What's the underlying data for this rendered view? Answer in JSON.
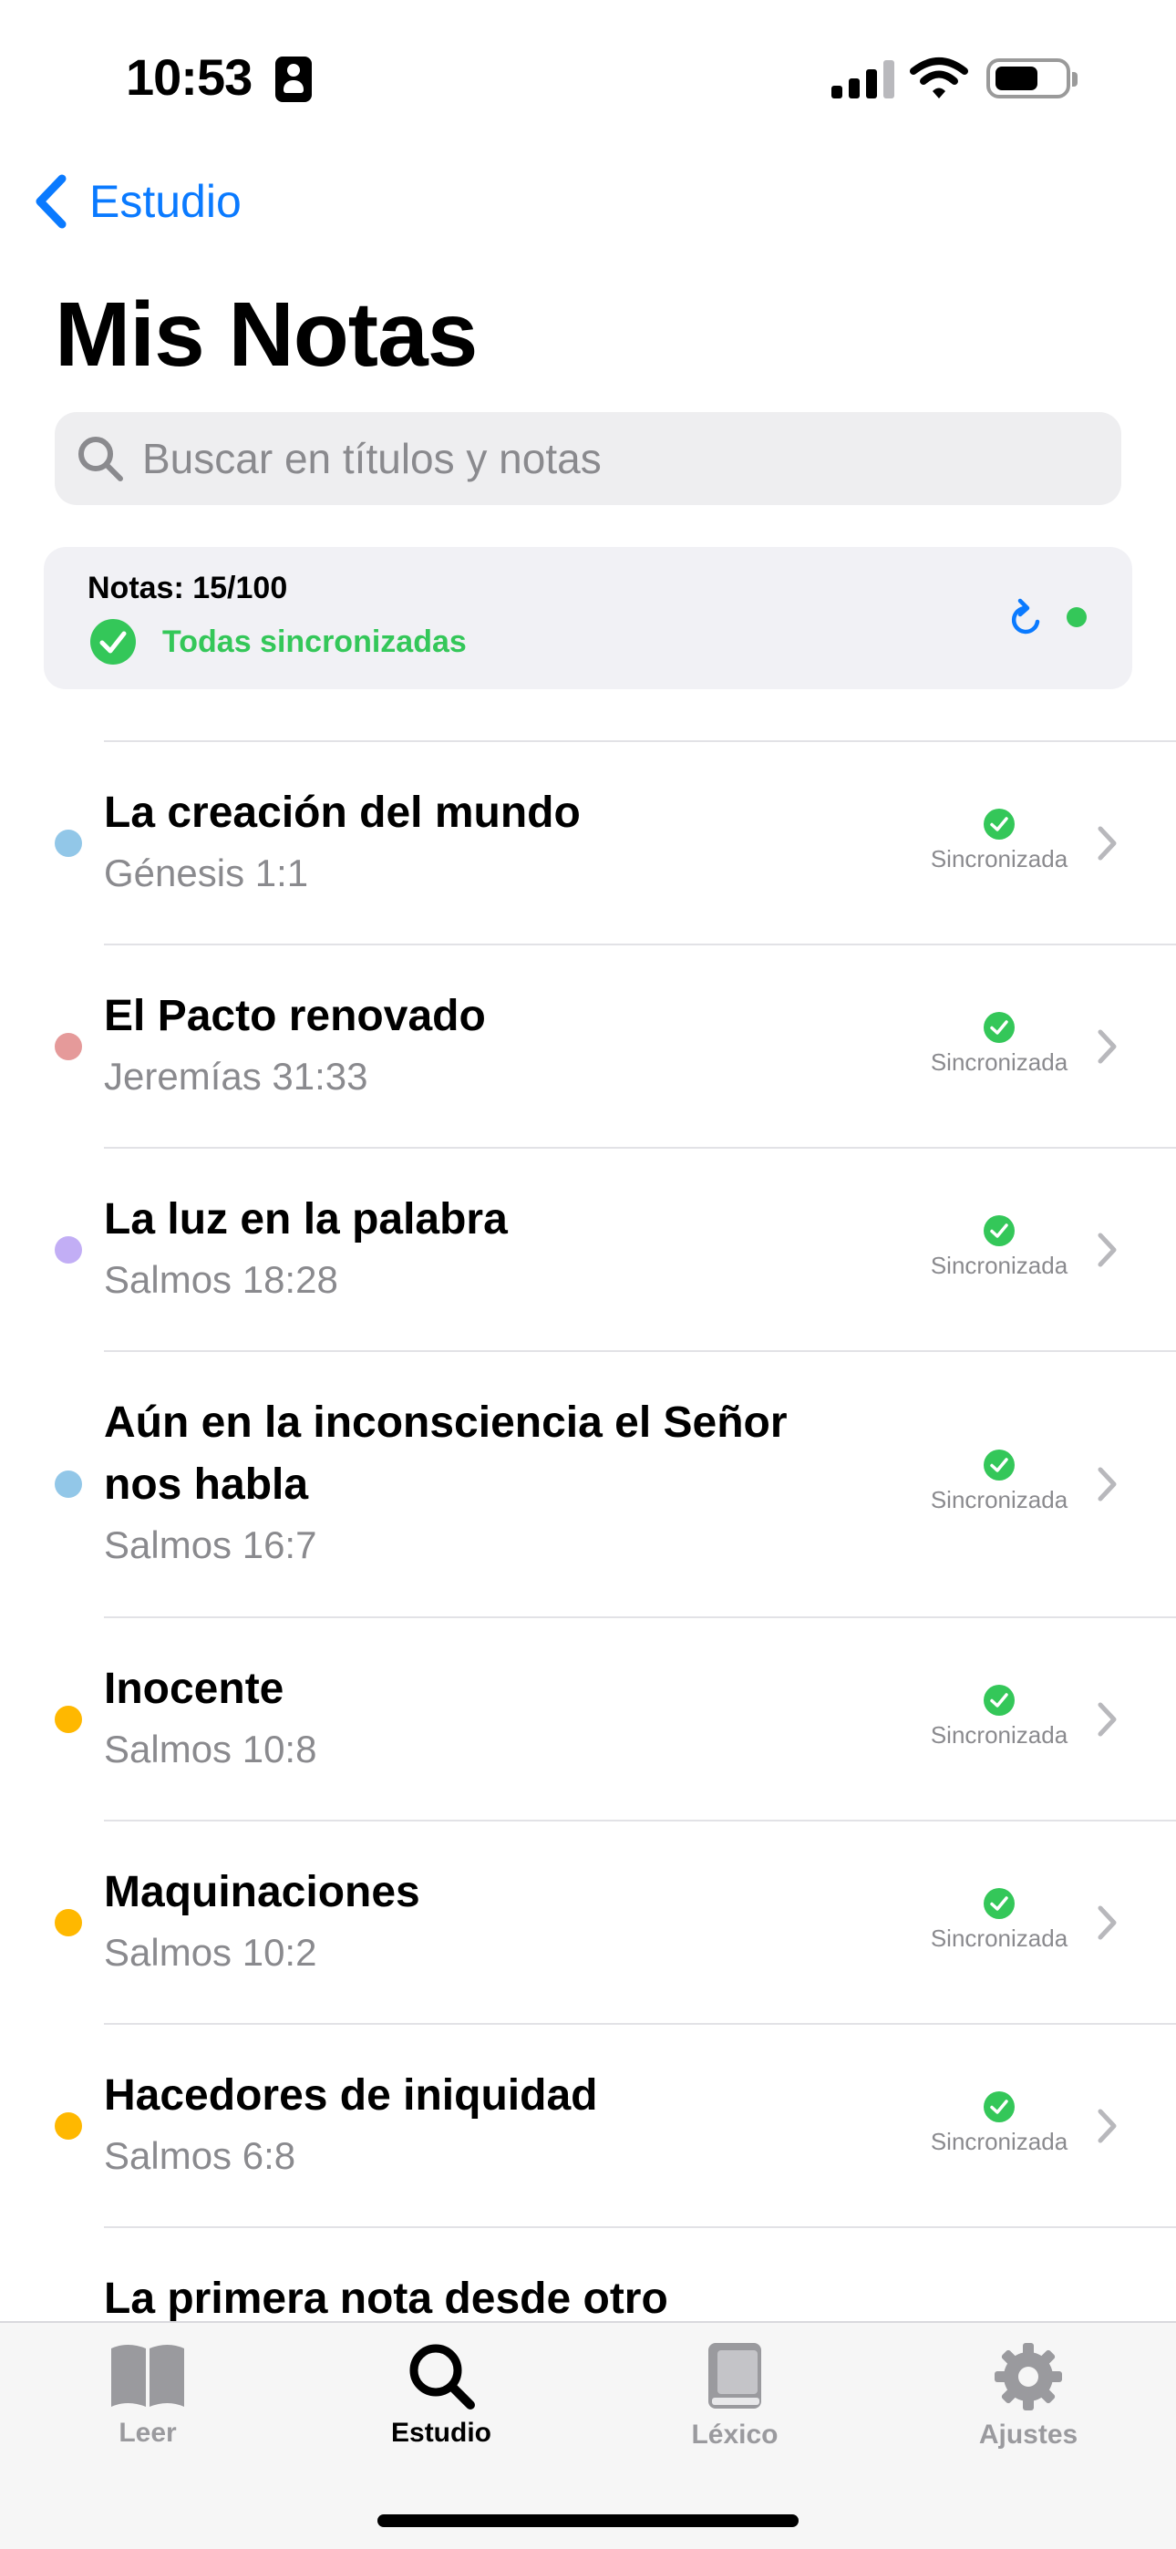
{
  "status_bar": {
    "time": "10:53"
  },
  "nav": {
    "back_label": "Estudio",
    "title": "Mis Notas"
  },
  "search": {
    "placeholder": "Buscar en títulos y notas"
  },
  "summary": {
    "count_text": "Notas: 15/100",
    "sync_text": "Todas sincronizadas"
  },
  "notes": [
    {
      "title": "La creación del mundo",
      "reference": "Génesis 1:1",
      "color": "#92c7e8",
      "status": "Sincronizada"
    },
    {
      "title": "El Pacto renovado",
      "reference": "Jeremías 31:33",
      "color": "#e59a9a",
      "status": "Sincronizada"
    },
    {
      "title": "La luz en la palabra",
      "reference": "Salmos 18:28",
      "color": "#c2aef5",
      "status": "Sincronizada"
    },
    {
      "title": "Aún en la inconsciencia el Señor nos habla",
      "reference": "Salmos 16:7",
      "color": "#92c7e8",
      "status": "Sincronizada"
    },
    {
      "title": "Inocente",
      "reference": "Salmos 10:8",
      "color": "#ffb800",
      "status": "Sincronizada"
    },
    {
      "title": "Maquinaciones",
      "reference": "Salmos 10:2",
      "color": "#ffb800",
      "status": "Sincronizada"
    },
    {
      "title": "Hacedores de iniquidad",
      "reference": "Salmos 6:8",
      "color": "#ffb800",
      "status": "Sincronizada"
    },
    {
      "title": "La primera nota desde otro",
      "reference": "",
      "color": "",
      "status": ""
    }
  ],
  "tabs": [
    {
      "label": "Leer",
      "icon": "book-open-icon",
      "active": false
    },
    {
      "label": "Estudio",
      "icon": "search-icon",
      "active": true
    },
    {
      "label": "Léxico",
      "icon": "book-closed-icon",
      "active": false
    },
    {
      "label": "Ajustes",
      "icon": "gear-icon",
      "active": false
    }
  ],
  "colors": {
    "accent": "#0a7aff",
    "success": "#34c759",
    "secondary_text": "#8a8a8e"
  }
}
